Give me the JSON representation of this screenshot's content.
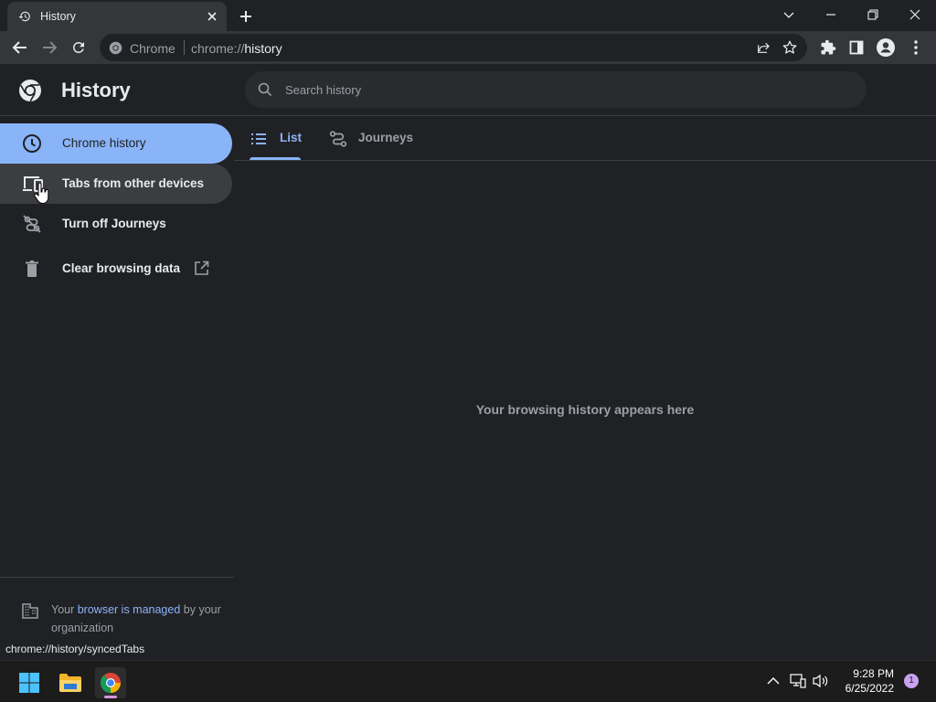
{
  "browser": {
    "tab_title": "History",
    "omnibox_chip": "Chrome",
    "url_scheme": "chrome://",
    "url_host": "history"
  },
  "page": {
    "title": "History",
    "search_placeholder": "Search history"
  },
  "sidebar": {
    "items": [
      {
        "label": "Chrome history",
        "icon": "clock-icon",
        "state": "selected"
      },
      {
        "label": "Tabs from other devices",
        "icon": "devices-icon",
        "state": "hover"
      },
      {
        "label": "Turn off Journeys",
        "icon": "journeys-off-icon"
      },
      {
        "label": "Clear browsing data",
        "icon": "trash-icon",
        "trailing_icon": "open-external-icon"
      }
    ],
    "managed": {
      "prefix": "Your ",
      "link": "browser is managed",
      "suffix": " by your organization"
    }
  },
  "main": {
    "tabs": [
      {
        "label": "List",
        "icon": "list-icon",
        "active": true
      },
      {
        "label": "Journeys",
        "icon": "journeys-icon",
        "active": false
      }
    ],
    "empty_message": "Your browsing history appears here"
  },
  "status_url": "chrome://history/syncedTabs",
  "taskbar": {
    "time": "9:28 PM",
    "date": "6/25/2022",
    "notification_count": "1"
  },
  "colors": {
    "accent": "#8ab4f8",
    "background": "#202124",
    "toolbar": "#35363a"
  }
}
